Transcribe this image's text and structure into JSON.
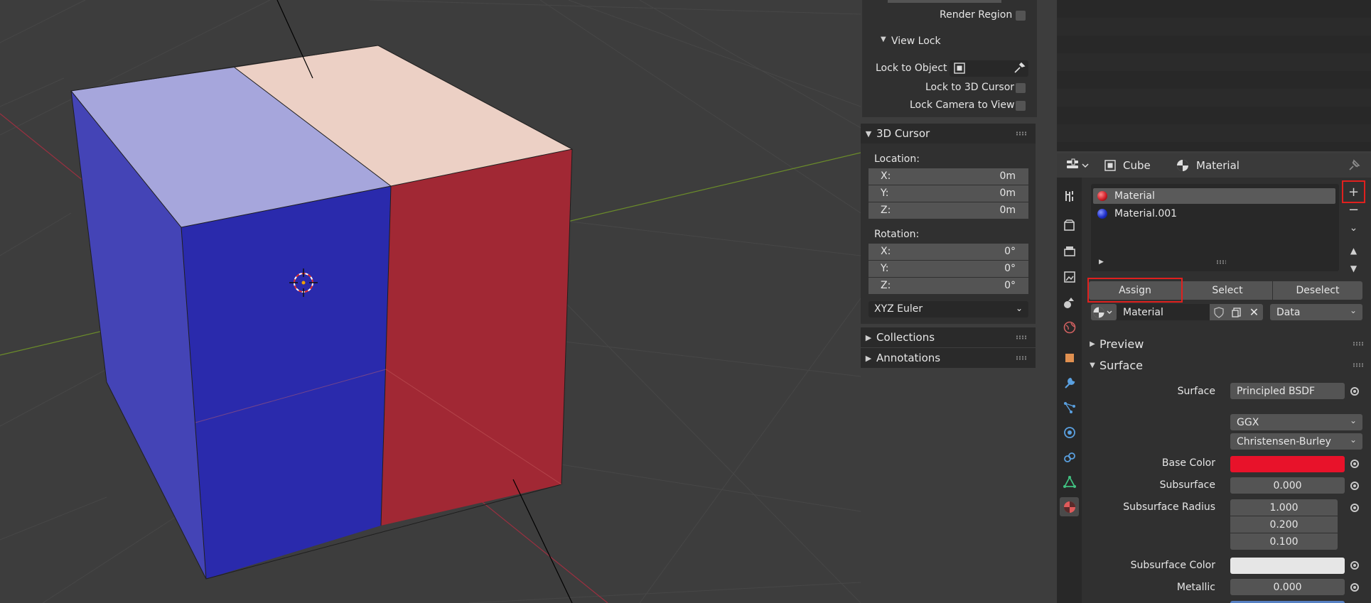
{
  "viewport": {
    "face_colors": {
      "left_blue": "#4040b8",
      "front_blue": "#2828b0",
      "front_red": "#a02834",
      "top_blue": "#a6a6de",
      "top_pink": "#ecd0c6",
      "right_red": "#9a2a33"
    }
  },
  "nsidebar": {
    "render_region_label": "Render Region",
    "view_lock": {
      "title": "View Lock",
      "lock_to_object_label": "Lock to Object",
      "lock_to_3d_cursor_label": "Lock to 3D Cursor",
      "lock_camera_to_view_label": "Lock Camera to View"
    },
    "cursor": {
      "title": "3D Cursor",
      "location_label": "Location:",
      "location": [
        {
          "axis": "X:",
          "value": "0m"
        },
        {
          "axis": "Y:",
          "value": "0m"
        },
        {
          "axis": "Z:",
          "value": "0m"
        }
      ],
      "rotation_label": "Rotation:",
      "rotation": [
        {
          "axis": "X:",
          "value": "0°"
        },
        {
          "axis": "Y:",
          "value": "0°"
        },
        {
          "axis": "Z:",
          "value": "0°"
        }
      ],
      "rotation_mode": "XYZ Euler"
    },
    "collections_title": "Collections",
    "annotations_title": "Annotations"
  },
  "properties": {
    "breadcrumb": {
      "object": "Cube",
      "material": "Material"
    },
    "slots": [
      {
        "name": "Material",
        "color": "#d0202a",
        "selected": true
      },
      {
        "name": "Material.001",
        "color": "#2030c8",
        "selected": false
      }
    ],
    "assign_label": "Assign",
    "select_label": "Select",
    "deselect_label": "Deselect",
    "material_name": "Material",
    "link_mode": "Data",
    "preview_title": "Preview",
    "surface_title": "Surface",
    "surface": {
      "surface_label": "Surface",
      "surface_value": "Principled BSDF",
      "distribution": "GGX",
      "subsurface_method": "Christensen-Burley",
      "base_color_label": "Base Color",
      "base_color": "#e8122a",
      "subsurface_label": "Subsurface",
      "subsurface_value": "0.000",
      "subsurface_radius_label": "Subsurface Radius",
      "subsurface_radius": [
        "1.000",
        "0.200",
        "0.100"
      ],
      "subsurface_color_label": "Subsurface Color",
      "subsurface_color": "#e6e6e6",
      "metallic_label": "Metallic",
      "metallic_value": "0.000"
    }
  }
}
